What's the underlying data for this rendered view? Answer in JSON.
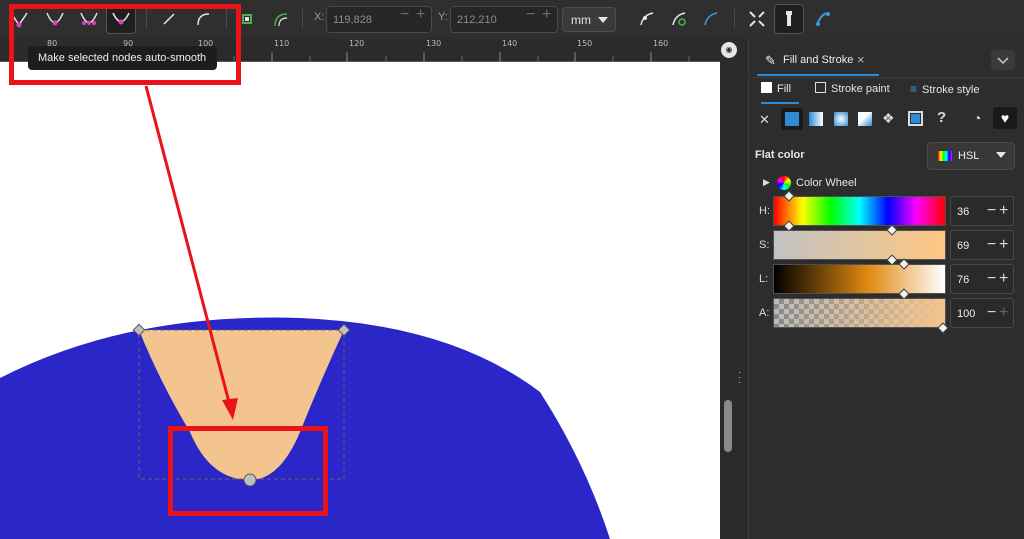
{
  "toolbar": {
    "x_label": "X:",
    "x_value": "119,828",
    "y_label": "Y:",
    "y_value": "212,210",
    "unit": "mm"
  },
  "ruler": {
    "ticks": [
      "80",
      "90",
      "100",
      "110",
      "120",
      "130",
      "140",
      "150",
      "160"
    ]
  },
  "tooltip": "Make selected nodes auto-smooth",
  "panel": {
    "tab_label": "Fill and Stroke",
    "subtabs": [
      "Fill",
      "Stroke paint",
      "Stroke style"
    ],
    "flat_color_label": "Flat color",
    "color_mode": "HSL",
    "color_wheel_label": "Color Wheel",
    "sliders": [
      {
        "label": "H:",
        "value": "36",
        "fraction": 0.09
      },
      {
        "label": "S:",
        "value": "69",
        "fraction": 0.69
      },
      {
        "label": "L:",
        "value": "76",
        "fraction": 0.76
      },
      {
        "label": "A:",
        "value": "100",
        "fraction": 1.0
      }
    ]
  },
  "colors": {
    "fill_shape": "#f4c48e",
    "blue_shape": "#2a26c8",
    "accent": "#e8141a",
    "node_handle": "#c0c0c0"
  }
}
